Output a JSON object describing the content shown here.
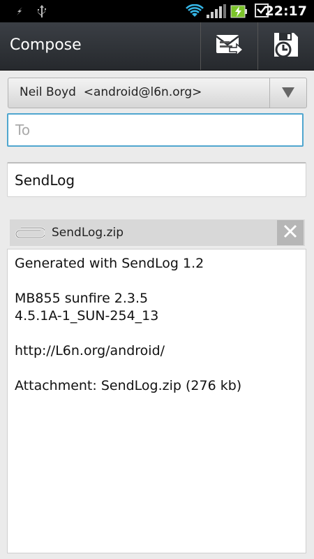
{
  "status_bar": {
    "time": "22:17",
    "icons": [
      "usb-debug-icon",
      "usb-icon",
      "wifi-icon",
      "signal-icon",
      "battery-charging-icon",
      "checkmark-notification-icon"
    ]
  },
  "action_bar": {
    "title": "Compose",
    "send_icon": "send-mail-icon",
    "save_icon": "save-draft-icon"
  },
  "from": {
    "value": "Neil Boyd  <android@l6n.org>"
  },
  "to": {
    "value": "",
    "placeholder": "To"
  },
  "subject": {
    "value": "SendLog"
  },
  "attachment": {
    "name": "SendLog.zip",
    "icon": "paperclip-icon",
    "remove_icon": "close-icon"
  },
  "body": {
    "lines": [
      "Generated with SendLog 1.2",
      "",
      "MB855 sunfire 2.3.5",
      "4.5.1A-1_SUN-254_13",
      "",
      "http://L6n.org/android/",
      "",
      "Attachment: SendLog.zip (276 kb)"
    ]
  },
  "colors": {
    "accent": "#4fa6cf",
    "action_bar": "#2f3236",
    "battery": "#7cc42a"
  }
}
